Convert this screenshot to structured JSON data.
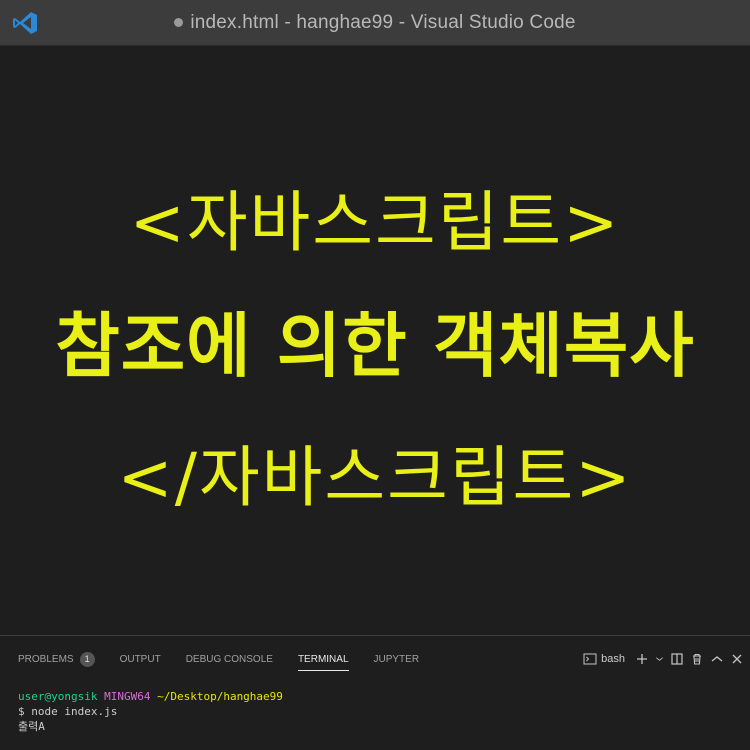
{
  "window": {
    "title": "index.html - hanghae99 - Visual Studio Code",
    "dirty": true
  },
  "hero": {
    "line1": "<자바스크립트>",
    "line2": "참조에 의한 객체복사",
    "line3": "</자바스크립트>",
    "color": "#e8f018"
  },
  "panel": {
    "tabs": [
      {
        "label": "PROBLEMS",
        "badge": "1",
        "active": false
      },
      {
        "label": "OUTPUT",
        "active": false
      },
      {
        "label": "DEBUG CONSOLE",
        "active": false
      },
      {
        "label": "TERMINAL",
        "active": true
      },
      {
        "label": "JUPYTER",
        "active": false
      }
    ],
    "shell": "bash",
    "actions": [
      "terminal-icon",
      "plus-icon",
      "chevron-down-icon",
      "split-icon",
      "trash-icon",
      "chevron-up-icon",
      "close-icon"
    ]
  },
  "terminal": {
    "user": "user@yongsik",
    "host": "MINGW64",
    "path": "~/Desktop/hanghae99",
    "command": "$ node index.js",
    "output": "출력A"
  }
}
